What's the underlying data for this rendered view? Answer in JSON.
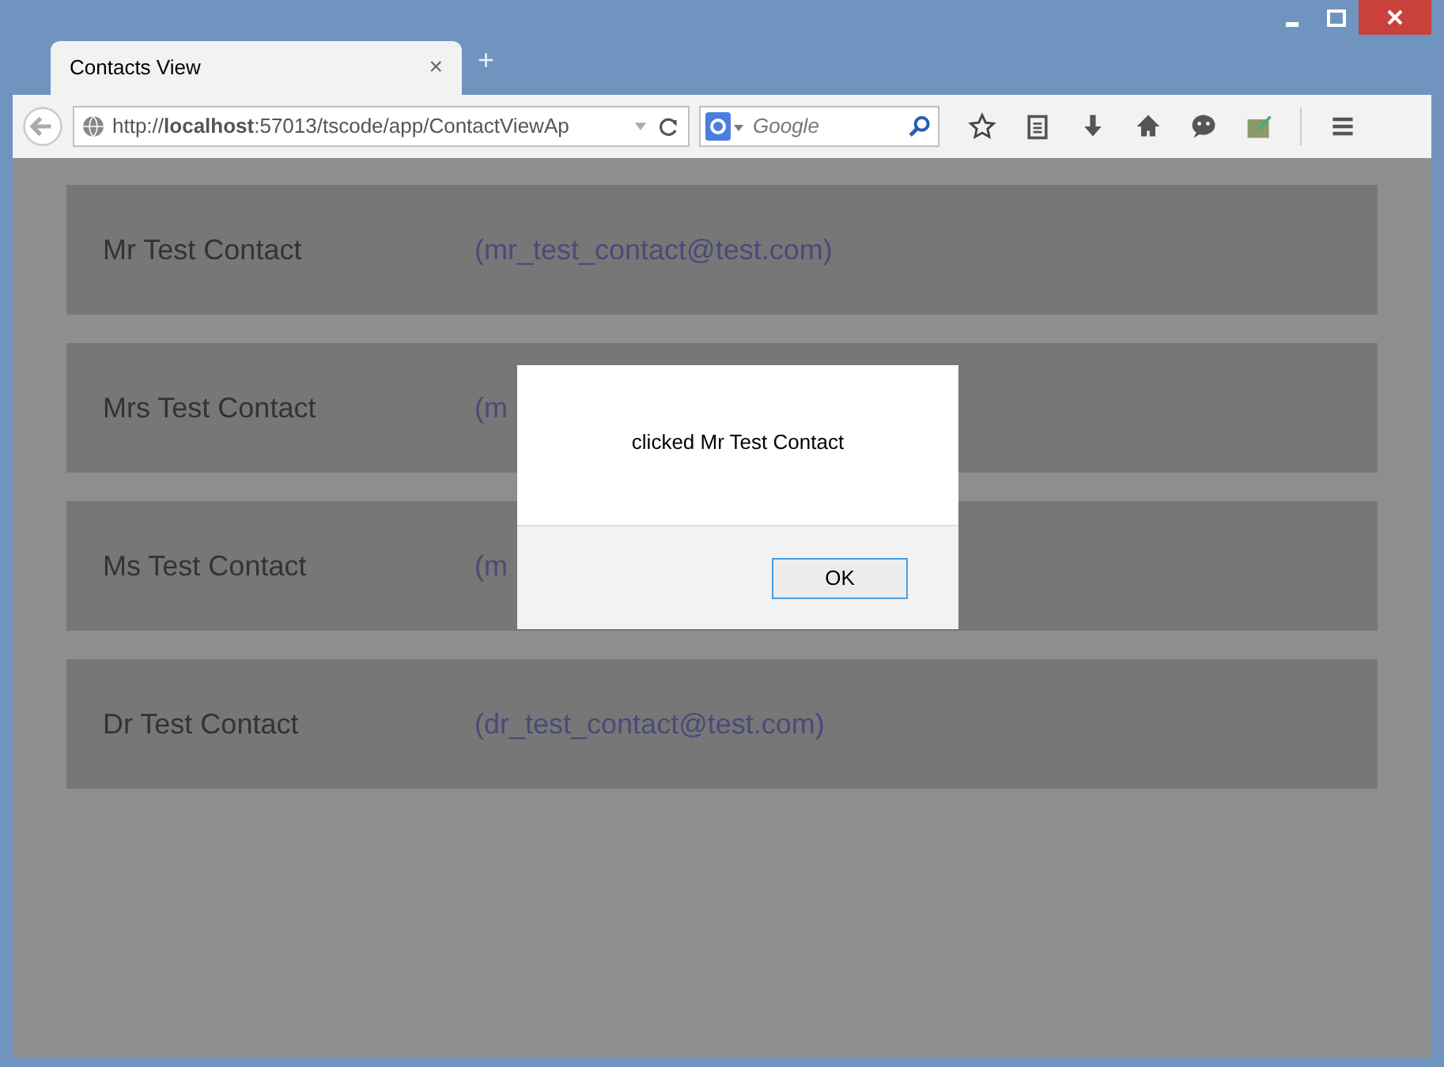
{
  "browser": {
    "tab": {
      "title": "Contacts View",
      "close": "×",
      "new_tab": "+"
    },
    "address": "http://**localhost**:57013/tscode/app/ContactViewAp",
    "search": {
      "placeholder": "Google"
    }
  },
  "contacts": [
    {
      "name": "Mr Test Contact",
      "email": "(mr_test_contact@test.com)"
    },
    {
      "name": "Mrs Test Contact",
      "email": "(m"
    },
    {
      "name": "Ms Test Contact",
      "email": "(m"
    },
    {
      "name": "Dr Test Contact",
      "email": "(dr_test_contact@test.com)"
    }
  ],
  "dialog": {
    "message": "clicked Mr Test Contact",
    "button": "OK"
  }
}
